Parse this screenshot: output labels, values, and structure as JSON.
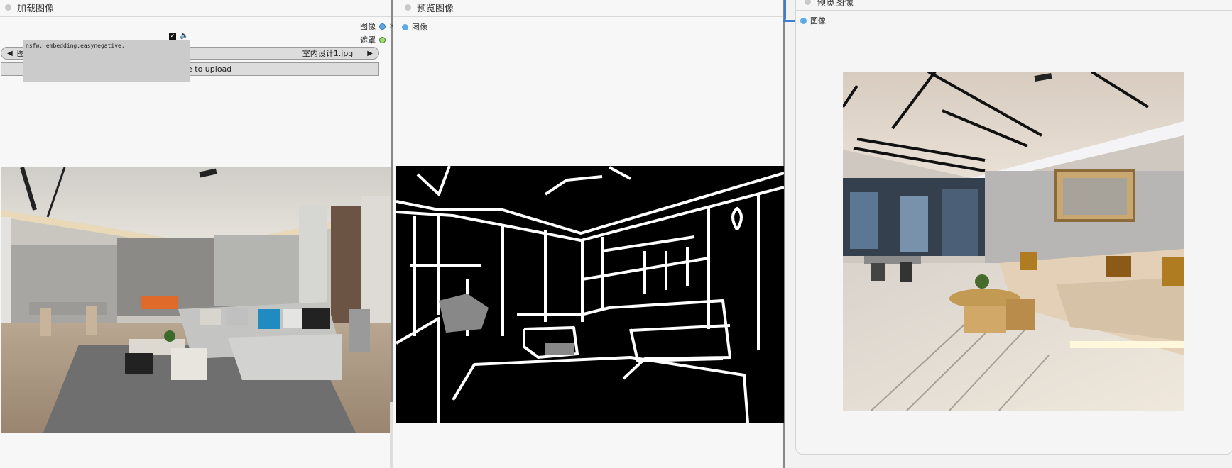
{
  "nodes": {
    "load_image": {
      "title": "加载图像",
      "outputs": [
        {
          "label": "图像",
          "color": "#5ba9e6"
        },
        {
          "label": "遮罩",
          "color": "#9ee06b"
        }
      ],
      "combo": {
        "label": "图像",
        "value": "室内设计1.jpg"
      },
      "upload_label": "e to upload",
      "tooltip_text": "nsfw, embedding:easynegative,"
    },
    "preview_image_1": {
      "title": "预览图像",
      "input_label": "图像"
    },
    "preview_image_2": {
      "title": "预览图像",
      "input_label": "图像"
    }
  },
  "colors": {
    "link_wire": "#3c7fd0",
    "node_bg": "#f7f7f7",
    "canvas_bg": "#f2f2f2"
  },
  "icons": {
    "combo_left": "triangle-left-icon",
    "combo_right": "triangle-right-icon",
    "speaker": "speaker-icon",
    "checkbox": "checkbox-icon"
  }
}
